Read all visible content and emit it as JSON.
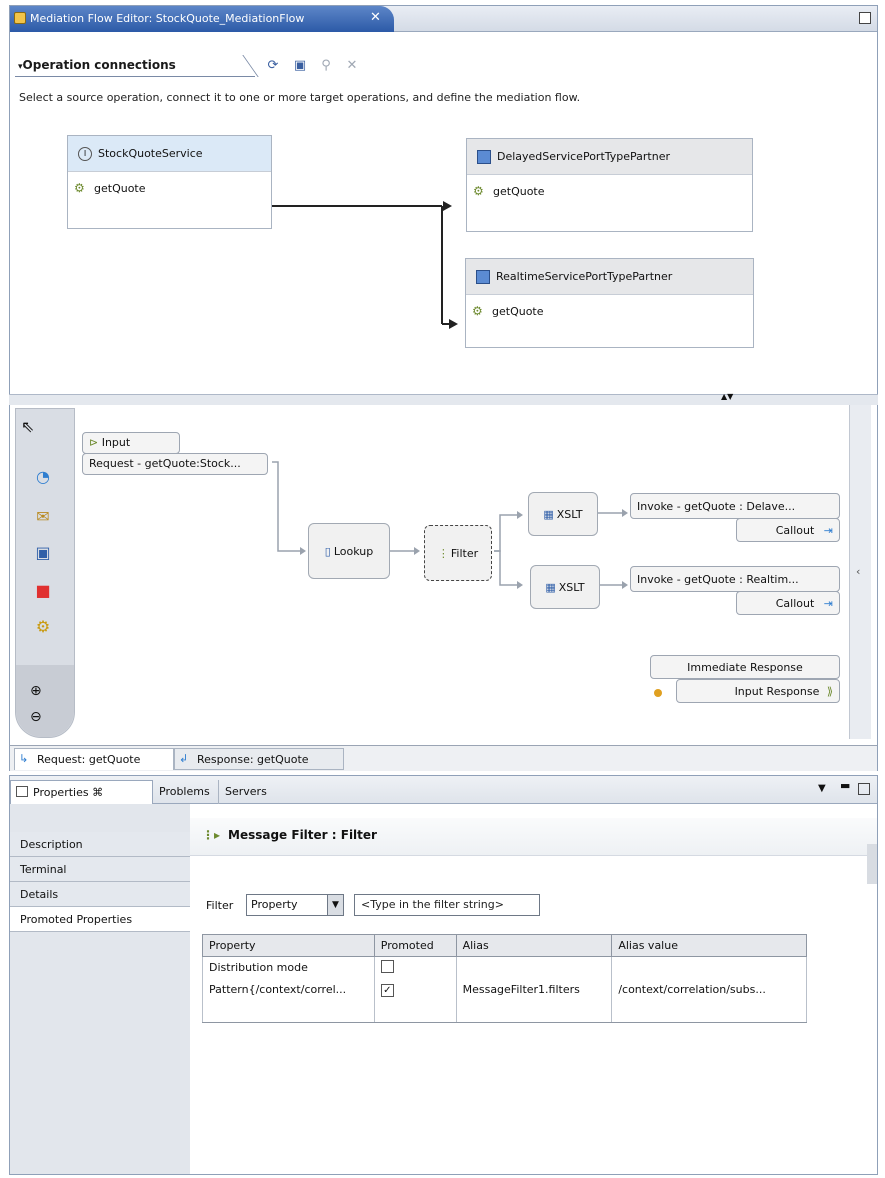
{
  "editor": {
    "tab_title": "Mediation Flow Editor: StockQuote_MediationFlow",
    "close_glyph": "✕"
  },
  "operation_connections": {
    "header": "Operation connections",
    "description": "Select a source operation, connect it to one or more target operations, and define the mediation flow.",
    "source": {
      "service": "StockQuoteService",
      "operation": "getQuote"
    },
    "targets": [
      {
        "partner": "DelayedServicePortTypePartner",
        "operation": "getQuote"
      },
      {
        "partner": "RealtimeServicePortTypePartner",
        "operation": "getQuote"
      }
    ]
  },
  "flow": {
    "input_label": "Input",
    "input_terminal": "Request - getQuote:Stock...",
    "lookup": "Lookup",
    "filter": "Filter",
    "xslt1": "XSLT",
    "xslt2": "XSLT",
    "invoke1": "Invoke - getQuote : Delave...",
    "invoke2": "Invoke - getQuote : Realtim...",
    "callout1": "Callout",
    "callout2": "Callout",
    "immediate_response": "Immediate Response",
    "input_response": "Input Response",
    "tabs": [
      "Request: getQuote",
      "Response: getQuote"
    ]
  },
  "properties_view": {
    "tabs": [
      "Properties ⌘",
      "Problems",
      "Servers"
    ],
    "nav": [
      "Description",
      "Terminal",
      "Details",
      "Promoted Properties"
    ],
    "title": "Message Filter : Filter",
    "filter_label": "Filter",
    "filter_select": "Property",
    "filter_placeholder": "<Type in the filter string>",
    "table": {
      "headers": [
        "Property",
        "Promoted",
        "Alias",
        "Alias value"
      ],
      "rows": [
        {
          "property": "Distribution mode",
          "promoted": false,
          "alias": "",
          "alias_value": ""
        },
        {
          "property": "Pattern{/context/correl...",
          "promoted": true,
          "alias": "MessageFilter1.filters",
          "alias_value": "/context/correlation/subs..."
        }
      ]
    }
  },
  "colors": {
    "active_tab": "#2c5aa7",
    "source_header": "#dbe9f7",
    "target_header": "#e6e7e9"
  },
  "icons": [
    "select-arrow-icon",
    "connection-icon",
    "mail-icon",
    "service-icon",
    "error-icon",
    "callout-icon",
    "zoom-in-icon",
    "zoom-out-icon"
  ]
}
